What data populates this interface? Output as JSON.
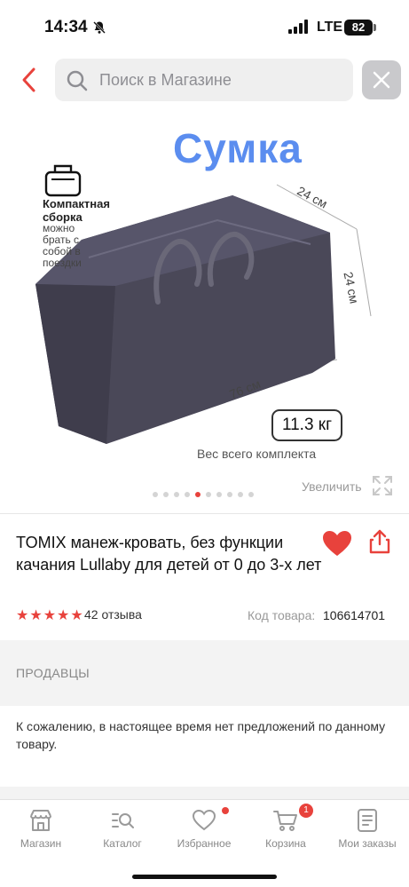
{
  "status_bar": {
    "time": "14:34",
    "network": "LTE",
    "battery": "82"
  },
  "search": {
    "placeholder": "Поиск в Магазине"
  },
  "product_image": {
    "title": "Сумка",
    "compact_title": "Компактная сборка",
    "compact_subtitle": "можно брать с собой в поездки",
    "dim_depth": "24 см",
    "dim_height": "24 см",
    "dim_length": "76 см",
    "weight": "11.3 кг",
    "weight_caption": "Вес всего комплекта",
    "dots_total": 10,
    "dots_active": 5
  },
  "zoom": {
    "label": "Увеличить"
  },
  "product": {
    "title": "TOMIX манеж-кровать, без функции качания Lullaby для детей от 0 до 3-х лет",
    "rating": 5,
    "reviews": "42 отзыва",
    "code_label": "Код товара:",
    "code_value": "106614701"
  },
  "sellers": {
    "header": "ПРОДАВЦЫ",
    "message": "К сожалению, в настоящее время нет предложений по данному товару."
  },
  "nav": {
    "items": [
      {
        "label": "Магазин",
        "icon": "store-icon"
      },
      {
        "label": "Каталог",
        "icon": "catalog-icon"
      },
      {
        "label": "Избранное",
        "icon": "heart-icon"
      },
      {
        "label": "Корзина",
        "icon": "cart-icon",
        "badge": "1"
      },
      {
        "label": "Мои заказы",
        "icon": "orders-icon"
      }
    ]
  },
  "colors": {
    "accent": "#e8423c",
    "image_title": "#5b8def",
    "bag": "#4a4858"
  }
}
